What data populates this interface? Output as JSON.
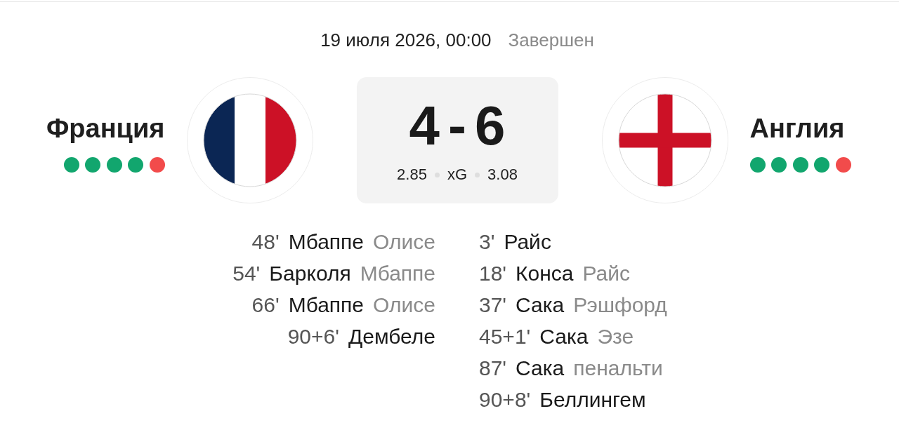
{
  "match": {
    "date": "19 июля 2026, 00:00",
    "status": "Завершен"
  },
  "home": {
    "name": "Франция",
    "form": [
      {
        "color": "#12a66e"
      },
      {
        "color": "#12a66e"
      },
      {
        "color": "#12a66e"
      },
      {
        "color": "#12a66e"
      },
      {
        "color": "#f24b4b"
      }
    ]
  },
  "score": {
    "home": "4",
    "separator": "-",
    "away": "6"
  },
  "xg": {
    "home": "2.85",
    "label": "xG",
    "away": "3.08"
  },
  "away": {
    "name": "Англия",
    "form": [
      {
        "color": "#12a66e"
      },
      {
        "color": "#12a66e"
      },
      {
        "color": "#12a66e"
      },
      {
        "color": "#12a66e"
      },
      {
        "color": "#f24b4b"
      }
    ]
  },
  "goals": {
    "home": [
      {
        "minute": "48'",
        "scorer": "Мбаппе",
        "detail": "Олисе"
      },
      {
        "minute": "54'",
        "scorer": "Барколя",
        "detail": "Мбаппе"
      },
      {
        "minute": "66'",
        "scorer": "Мбаппе",
        "detail": "Олисе"
      },
      {
        "minute": "90+6'",
        "scorer": "Дембеле"
      }
    ],
    "away": [
      {
        "minute": "3'",
        "scorer": "Райс"
      },
      {
        "minute": "18'",
        "scorer": "Конса",
        "detail": "Райс"
      },
      {
        "minute": "37'",
        "scorer": "Сака",
        "detail": "Рэшфорд"
      },
      {
        "minute": "45+1'",
        "scorer": "Сака",
        "detail": "Эзе"
      },
      {
        "minute": "87'",
        "scorer": "Сака",
        "detail": "пенальти"
      },
      {
        "minute": "90+8'",
        "scorer": "Беллингем"
      }
    ]
  }
}
